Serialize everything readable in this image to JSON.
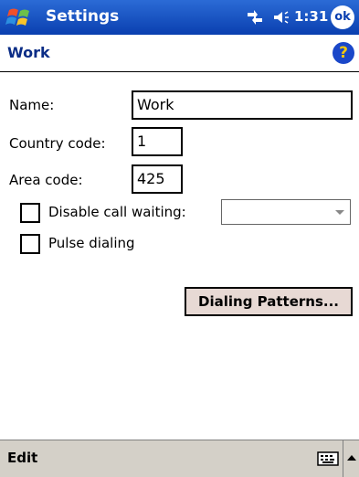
{
  "titlebar": {
    "title": "Settings",
    "time": "1:31",
    "ok_label": "ok",
    "start_icon": "windows-flag-icon",
    "connectivity_icon": "connectivity-icon",
    "volume_icon": "volume-icon"
  },
  "subheader": {
    "title": "Work",
    "help_label": "?"
  },
  "form": {
    "name_label": "Name:",
    "name_value": "Work",
    "country_code_label": "Country code:",
    "country_code_value": "1",
    "area_code_label": "Area code:",
    "area_code_value": "425",
    "disable_call_waiting_label": "Disable call waiting:",
    "disable_call_waiting_checked": false,
    "call_waiting_select_value": "",
    "pulse_dialing_label": "Pulse dialing",
    "pulse_dialing_checked": false,
    "dialing_patterns_button": "Dialing Patterns..."
  },
  "menubar": {
    "edit_label": "Edit",
    "keyboard_icon": "keyboard-icon"
  },
  "colors": {
    "titlebar": "#0a3fb0",
    "button_face": "#e7d9d4",
    "menubar": "#d4d0c8"
  }
}
